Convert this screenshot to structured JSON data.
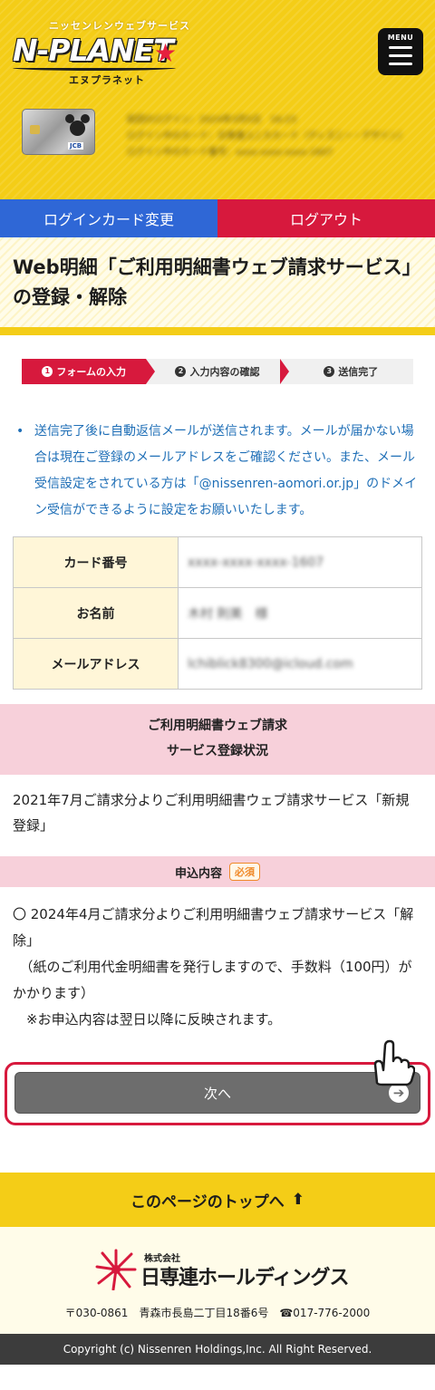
{
  "header": {
    "logo_tagline": "ニッセンレンウェブサービス",
    "logo_text": "N-PLANET",
    "logo_sub": "エヌプラネット",
    "menu_label": "MENU",
    "card_brand": "JCB",
    "user_info": [
      "前回のログイン：2024年3月5日　16:23",
      "ログイン中のカード：日専連ユニカカード（ディズニー・デザイン）",
      "ログイン中のカード番号：xxxx-xxxx-xxxx-1607"
    ],
    "change_card_label": "ログインカード変更",
    "logout_label": "ログアウト"
  },
  "page_title": "Web明細「ご利用明細書ウェブ請求サービス」の登録・解除",
  "steps": [
    {
      "num": "1",
      "label": "フォームの入力",
      "active": true
    },
    {
      "num": "2",
      "label": "入力内容の確認",
      "active": false
    },
    {
      "num": "3",
      "label": "送信完了",
      "active": false
    }
  ],
  "notice": "送信完了後に自動返信メールが送信されます。メールが届かない場合は現在ご登録のメールアドレスをご確認ください。また、メール受信設定をされている方は「@nissenren-aomori.or.jp」のドメイン受信ができるように設定をお願いいたします。",
  "info_table": [
    {
      "label": "カード番号",
      "value": "xxxx-xxxx-xxxx-1607"
    },
    {
      "label": "お名前",
      "value": "木村 則美　様"
    },
    {
      "label": "メールアドレス",
      "value": "lchiblick8300@icloud.com"
    }
  ],
  "registration_status": {
    "heading_line1": "ご利用明細書ウェブ請求",
    "heading_line2": "サービス登録状況",
    "text": "2021年7月ご請求分よりご利用明細書ウェブ請求サービス「新規登録」"
  },
  "application": {
    "heading": "申込内容",
    "required_badge": "必須",
    "option_line1": "〇 2024年4月ご請求分よりご利用明細書ウェブ請求サービス「解除」",
    "option_line2": "　（紙のご利用代金明細書を発行しますので、手数料（100円）がかかります）",
    "option_line3": "　※お申込内容は翌日以降に反映されます。"
  },
  "next_button_label": "次へ",
  "page_top_label": "このページのトップへ",
  "footer": {
    "company_small": "株式会社",
    "company_name": "日専連ホールディングス",
    "address": "〒030-0861　青森市長島二丁目18番6号　☎017-776-2000",
    "copyright": "Copyright (c) Nissenren Holdings,Inc. All Right Reserved."
  }
}
